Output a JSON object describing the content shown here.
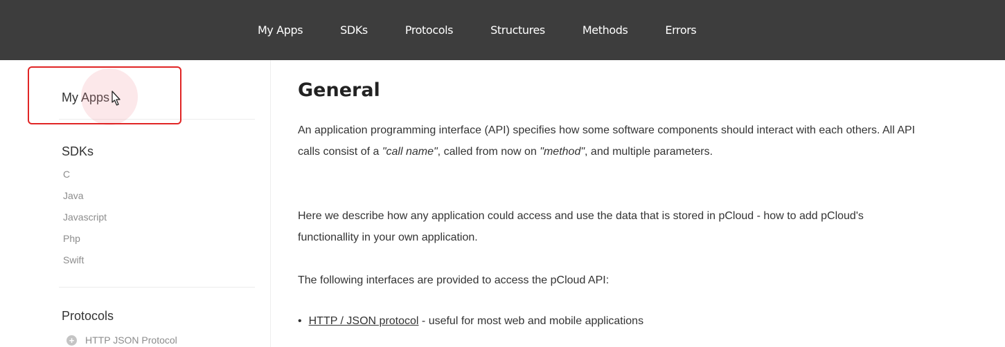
{
  "topnav": {
    "items": [
      "My Apps",
      "SDKs",
      "Protocols",
      "Structures",
      "Methods",
      "Errors"
    ]
  },
  "sidebar": {
    "my_apps": "My Apps",
    "sdks": {
      "heading": "SDKs",
      "items": [
        "C",
        "Java",
        "Javascript",
        "Php",
        "Swift"
      ]
    },
    "protocols": {
      "heading": "Protocols",
      "first_item": "HTTP JSON Protocol"
    }
  },
  "main": {
    "title": "General",
    "intro": {
      "part1": "An application programming interface (API) specifies how some software components should interact with each others. All API calls consist of a ",
      "call_name": "\"call name\"",
      "part2": ", called from now on ",
      "method": "\"method\"",
      "part3": ", and multiple parameters."
    },
    "describe": "Here we describe how any application could access and use the data that is stored in pCloud - how to add pCloud's functionallity in your own application.",
    "interfaces_intro": "The following interfaces are provided to access the pCloud API:",
    "bullets": [
      {
        "link": "HTTP / JSON protocol",
        "text": " - useful for most web and mobile applications"
      }
    ]
  },
  "colors": {
    "topbar": "#3d3d3d",
    "highlight": "#e02424"
  },
  "icons": [
    "plus-circle-icon",
    "mouse-pointer-icon"
  ]
}
